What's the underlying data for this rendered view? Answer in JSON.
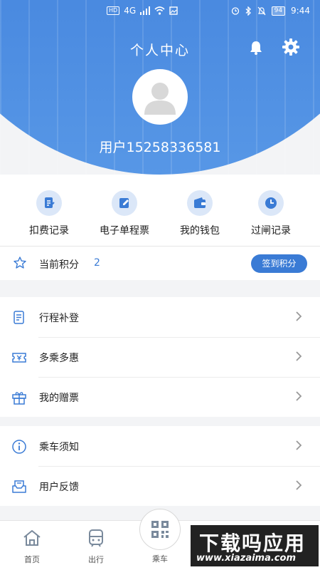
{
  "status_bar": {
    "network_tag": "HD",
    "signal": "4G",
    "battery": "94",
    "time": "9:44"
  },
  "header": {
    "title": "个人中心",
    "username": "用户15258336581",
    "bg_color": "#3d7ed9"
  },
  "quick_actions": [
    {
      "label": "扣费记录",
      "icon": "receipt-icon"
    },
    {
      "label": "电子单程票",
      "icon": "ticket-edit-icon"
    },
    {
      "label": "我的钱包",
      "icon": "wallet-icon"
    },
    {
      "label": "过闸记录",
      "icon": "clock-icon"
    }
  ],
  "points": {
    "label": "当前积分",
    "value": "2",
    "button": "签到积分"
  },
  "menu_group_1": [
    {
      "label": "行程补登",
      "icon": "document-icon"
    },
    {
      "label": "多乘多惠",
      "icon": "coupon-icon"
    },
    {
      "label": "我的赠票",
      "icon": "gift-icon"
    }
  ],
  "menu_group_2": [
    {
      "label": "乘车须知",
      "icon": "info-icon"
    },
    {
      "label": "用户反馈",
      "icon": "feedback-icon"
    }
  ],
  "tabbar": {
    "home": "首页",
    "travel": "出行",
    "ride": "乘车"
  },
  "watermark": {
    "cn": "下载吗应用",
    "en": "www.xiazaima.com"
  },
  "accent_color": "#3a7bd5"
}
